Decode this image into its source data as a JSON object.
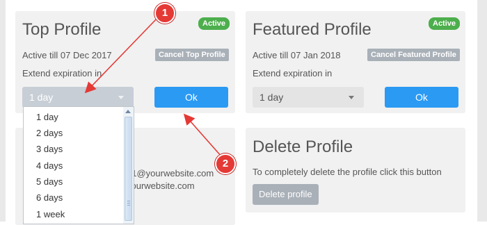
{
  "top_profile": {
    "title": "Top Profile",
    "badge": "Active",
    "active_till": "Active till 07 Dec 2017",
    "cancel_label": "Cancel Top Profile",
    "extend_label": "Extend expiration in",
    "select_value": "1 day",
    "ok_label": "Ok"
  },
  "featured_profile": {
    "title": "Featured Profile",
    "badge": "Active",
    "active_till": "Active till 07 Jan 2018",
    "cancel_label": "Cancel Featured Profile",
    "extend_label": "Extend expiration in",
    "select_value": "1 day",
    "ok_label": "Ok"
  },
  "contact": {
    "email_1": "31@yourwebsite.com",
    "email_2": "yourwebsite.com"
  },
  "delete_profile": {
    "title": "Delete Profile",
    "description": "To completely delete the profile click this button",
    "button_label": "Delete profile"
  },
  "dropdown_options": [
    "1 day",
    "2 days",
    "3 days",
    "4 days",
    "5 days",
    "6 days",
    "1 week"
  ],
  "markers": [
    "1",
    "2"
  ],
  "colors": {
    "badge_green": "#4cae4c",
    "ok_blue": "#2b9af3",
    "marker_red": "#e53935"
  }
}
